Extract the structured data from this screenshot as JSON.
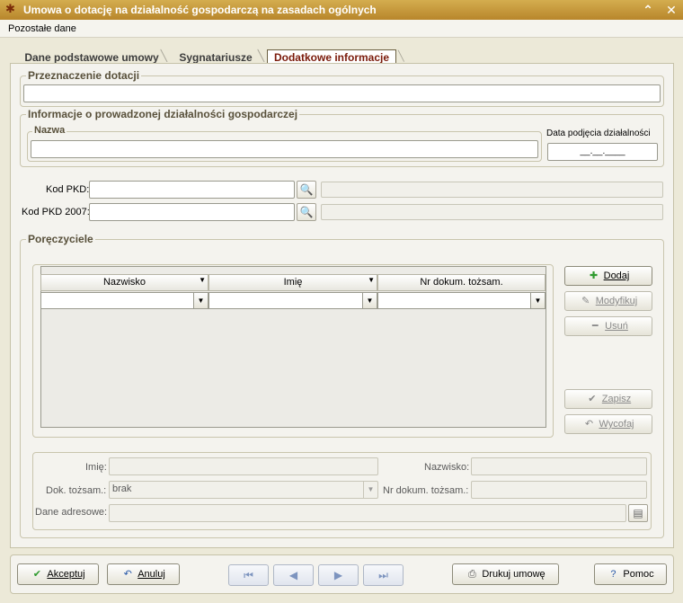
{
  "window": {
    "title": "Umowa o dotację na działalność gospodarczą na zasadach ogólnych",
    "min_glyph": "⌃",
    "close_glyph": "✕"
  },
  "menu": {
    "label": "Pozostałe dane"
  },
  "tabs": [
    {
      "label": "Dane podstawowe umowy",
      "active": false
    },
    {
      "label": "Sygnatariusze",
      "active": false
    },
    {
      "label": "Dodatkowe informacje",
      "active": true
    }
  ],
  "przeznaczenie": {
    "title": "Przeznaczenie dotacji",
    "value": ""
  },
  "dzialalnosc": {
    "title": "Informacje o prowadzonej działalności gospodarczej",
    "nazwa_title": "Nazwa",
    "nazwa_value": "",
    "data_label": "Data podjęcia działalności",
    "data_value": "__.__.____"
  },
  "pkd": {
    "kod_pkd_label": "Kod PKD:",
    "kod_pkd_value": "",
    "kod_pkd_desc": "",
    "kod_pkd2007_label": "Kod PKD 2007:",
    "kod_pkd2007_value": "",
    "kod_pkd2007_desc": ""
  },
  "poreczyciele": {
    "title": "Poręczyciele",
    "columns": [
      "Nazwisko",
      "Imię",
      "Nr dokum. tożsam."
    ],
    "rows": [],
    "buttons": {
      "dodaj": "Dodaj",
      "modyfikuj": "Modyfikuj",
      "usun": "Usuń",
      "zapisz": "Zapisz",
      "wycofaj": "Wycofaj"
    },
    "details": {
      "imie_label": "Imię:",
      "imie_value": "",
      "nazwisko_label": "Nazwisko:",
      "nazwisko_value": "",
      "dok_label": "Dok. tożsam.:",
      "dok_value": "brak",
      "nr_dok_label": "Nr dokum. tożsam.:",
      "nr_dok_value": "",
      "adres_label": "Dane adresowe:",
      "adres_value": ""
    }
  },
  "footer": {
    "akceptuj": "Akceptuj",
    "anuluj": "Anuluj",
    "drukuj": "Drukuj umowę",
    "pomoc": "Pomoc"
  },
  "colors": {
    "titlebar": "#c89a3e",
    "active_tab_text": "#7a1a0a",
    "group_title": "#58503a"
  }
}
